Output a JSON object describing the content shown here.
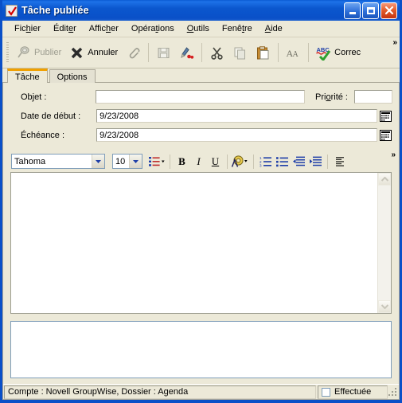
{
  "window": {
    "title": "Tâche publiée",
    "icon": "task-checkbox-icon",
    "accent_title_color": "#0A50C8",
    "dialog_bg_color": "#ECE9D8",
    "active_tab_accent_color": "#F0A000",
    "controls": {
      "minimize": "Réduire",
      "maximize": "Agrandir",
      "close": "Fermer"
    }
  },
  "menu": {
    "items": [
      {
        "label": "Fichier",
        "accel": "i"
      },
      {
        "label": "Éditer",
        "accel": "r"
      },
      {
        "label": "Afficher",
        "accel": "c"
      },
      {
        "label": "Opérations",
        "accel": "a"
      },
      {
        "label": "Outils",
        "accel": "O"
      },
      {
        "label": "Fenêtre",
        "accel": "ê"
      },
      {
        "label": "Aide",
        "accel": "A"
      }
    ]
  },
  "toolbar": {
    "overflow_label": "»",
    "buttons": [
      {
        "label": "Publier",
        "icon": "publish-icon",
        "disabled": true
      },
      {
        "label": "Annuler",
        "icon": "cancel-x-icon",
        "disabled": false
      },
      {
        "label": "",
        "icon": "attachment-paperclip-icon",
        "disabled": false
      },
      {
        "label": "",
        "icon": "save-floppy-icon",
        "disabled": true
      },
      {
        "label": "",
        "icon": "print-preview-icon",
        "disabled": false
      },
      {
        "label": "",
        "icon": "cut-scissors-icon",
        "disabled": false
      },
      {
        "label": "",
        "icon": "copy-icon",
        "disabled": true
      },
      {
        "label": "",
        "icon": "paste-clipboard-icon",
        "disabled": false
      },
      {
        "label": "",
        "icon": "font-aa-icon",
        "disabled": false
      },
      {
        "label": "Correc",
        "icon": "spellcheck-abc-icon",
        "disabled": false
      }
    ]
  },
  "tabs": [
    {
      "label": "Tâche",
      "active": true
    },
    {
      "label": "Options",
      "active": false
    }
  ],
  "form": {
    "subject": {
      "label": "Objet :",
      "value": "",
      "placeholder": ""
    },
    "priority": {
      "label": "Priorité :",
      "value": "",
      "placeholder": ""
    },
    "start_date": {
      "label": "Date de début :",
      "value": "9/23/2008",
      "button_icon": "calendar-icon"
    },
    "due_date": {
      "label": "Échéance :",
      "value": "9/23/2008",
      "button_icon": "calendar-icon"
    }
  },
  "format_bar": {
    "font": {
      "value": "Tahoma",
      "icon": "chevron-down-icon"
    },
    "size": {
      "value": "10",
      "icon": "chevron-down-icon"
    },
    "buttons": [
      {
        "name": "paragraph-style-dropdown",
        "glyph": "≣"
      },
      {
        "name": "bold-button",
        "glyph": "B"
      },
      {
        "name": "italic-button",
        "glyph": "I"
      },
      {
        "name": "underline-button",
        "glyph": "U"
      },
      {
        "name": "text-color-dropdown",
        "glyph": "A"
      },
      {
        "name": "numbered-list-button",
        "glyph": "1."
      },
      {
        "name": "bullet-list-button",
        "glyph": "•"
      },
      {
        "name": "decrease-indent-button",
        "glyph": "⇤"
      },
      {
        "name": "increase-indent-button",
        "glyph": "⇥"
      },
      {
        "name": "align-button",
        "glyph": "≡"
      }
    ],
    "overflow_label": "»"
  },
  "message_body": {
    "value": "",
    "placeholder": ""
  },
  "attachments": {
    "value": "",
    "placeholder": ""
  },
  "status_bar": {
    "info": "Compte : Novell GroupWise,  Dossier : Agenda",
    "completed": {
      "label": "Effectuée",
      "checked": false
    }
  }
}
